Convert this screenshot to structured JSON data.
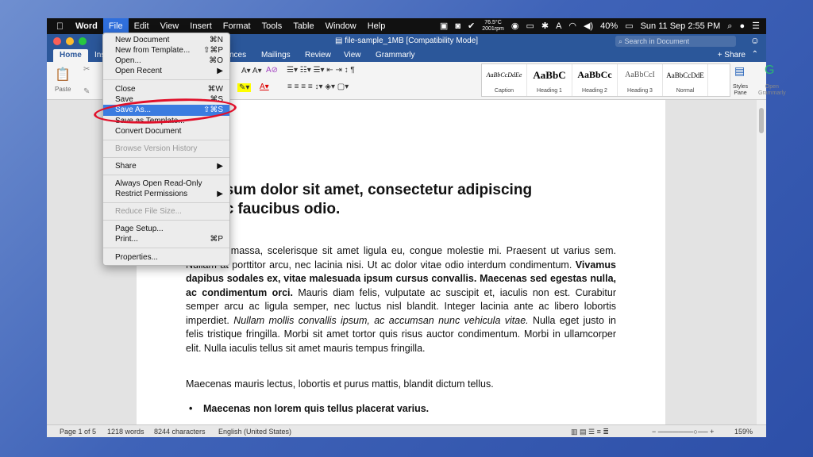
{
  "menubar": {
    "apple": "",
    "app": "Word",
    "items": [
      "File",
      "Edit",
      "View",
      "Insert",
      "Format",
      "Tools",
      "Table",
      "Window",
      "Help"
    ],
    "temp_top": "76.5°C",
    "temp_bottom": "2001rpm",
    "battery": "40%",
    "datetime": "Sun 11 Sep  2:55 PM"
  },
  "window": {
    "title": "file-sample_1MB [Compatibility Mode]",
    "search_placeholder": "Search in Document"
  },
  "tabs": {
    "home": "Home",
    "partial_ins": "Ins",
    "references_fragment": "nces",
    "mailings": "Mailings",
    "review": "Review",
    "view": "View",
    "grammarly": "Grammarly",
    "share": "+ Share"
  },
  "ribbon": {
    "paste": "Paste",
    "styles": [
      {
        "preview": "AaBbCcDdEe",
        "name": "Caption"
      },
      {
        "preview": "AaBbC",
        "name": "Heading 1"
      },
      {
        "preview": "AaBbCc",
        "name": "Heading 2"
      },
      {
        "preview": "AaBbCcI",
        "name": "Heading 3"
      },
      {
        "preview": "AaBbCcDdE",
        "name": "Normal"
      }
    ],
    "styles_pane": "Styles\nPane",
    "open_grammarly": "Open\nGrammarly"
  },
  "file_menu": {
    "items": [
      {
        "label": "New Document",
        "shortcut": "⌘N"
      },
      {
        "label": "New from Template...",
        "shortcut": "⇧⌘P"
      },
      {
        "label": "Open...",
        "shortcut": "⌘O"
      },
      {
        "label": "Open Recent",
        "shortcut": "▶"
      },
      {
        "label": "Close",
        "shortcut": "⌘W"
      },
      {
        "label": "Save",
        "shortcut": "⌘S"
      },
      {
        "label": "Save As...",
        "shortcut": "⇧⌘S"
      },
      {
        "label": "Save as Template...",
        "shortcut": ""
      },
      {
        "label": "Convert Document",
        "shortcut": ""
      },
      {
        "label": "Browse Version History",
        "shortcut": ""
      },
      {
        "label": "Share",
        "shortcut": "▶"
      },
      {
        "label": "Always Open Read-Only",
        "shortcut": ""
      },
      {
        "label": "Restrict Permissions",
        "shortcut": "▶"
      },
      {
        "label": "Reduce File Size...",
        "shortcut": ""
      },
      {
        "label": "Page Setup...",
        "shortcut": ""
      },
      {
        "label": "Print...",
        "shortcut": "⌘P"
      },
      {
        "label": "Properties...",
        "shortcut": ""
      }
    ]
  },
  "document": {
    "heading": "em ipsum dolor sit amet, consectetur adipiscing\nunc ac faucibus odio.",
    "para1_a": "m neque massa, scelerisque sit amet ligula eu, congue molestie mi. Praesent ut varius sem. Nullam at porttitor arcu, nec lacinia nisi. Ut ac dolor vitae odio interdum condimentum. ",
    "para1_b": "Vivamus dapibus sodales ex, vitae malesuada ipsum cursus convallis. Maecenas sed egestas nulla, ac condimentum orci.",
    "para1_c": " Mauris diam felis, vulputate ac suscipit et, iaculis non est. Curabitur semper arcu ac ligula semper, nec luctus nisl blandit. Integer lacinia ante ac libero lobortis imperdiet. ",
    "para1_d": "Nullam mollis convallis ipsum, ac accumsan nunc vehicula vitae.",
    "para1_e": " Nulla eget justo in felis tristique fringilla. Morbi sit amet tortor quis risus auctor condimentum. Morbi in ullamcorper elit. Nulla iaculis tellus sit amet mauris tempus fringilla.",
    "para2": "Maecenas mauris lectus, lobortis et purus mattis, blandit dictum tellus.",
    "bullet1": "Maecenas non lorem quis tellus placerat varius."
  },
  "status": {
    "page": "Page 1 of 5",
    "words": "1218 words",
    "chars": "8244 characters",
    "lang": "English (United States)",
    "zoom": "159%"
  }
}
